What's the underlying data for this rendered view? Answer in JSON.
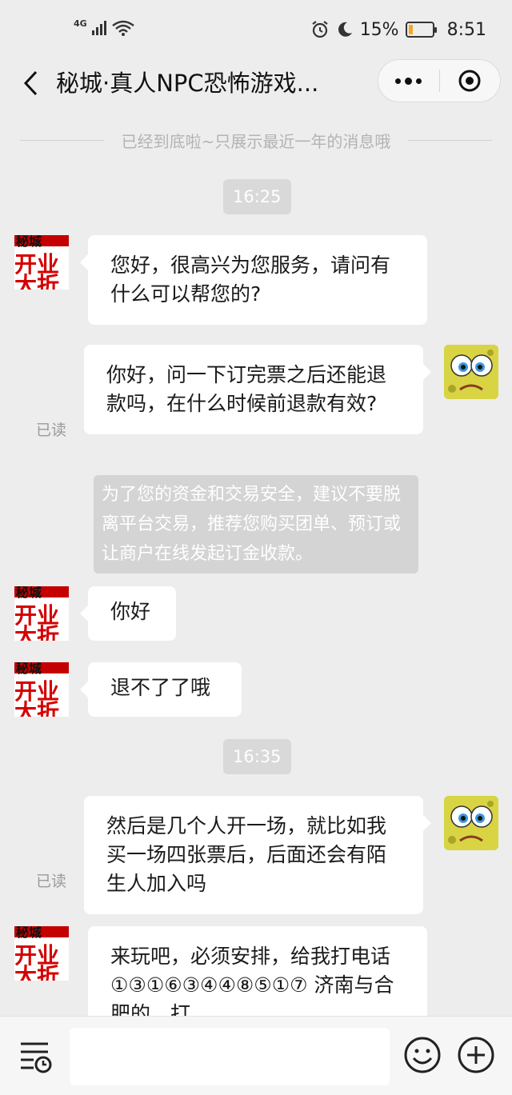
{
  "status_bar": {
    "network": "4G",
    "battery": "15%",
    "time": "8:51",
    "battery_level_percent": 15,
    "battery_color": "#f5a623"
  },
  "header": {
    "title": "秘城·真人NPC恐怖游戏..."
  },
  "chat": {
    "history_note": "已经到底啦~只展示最近一年的消息哦",
    "messages": [
      {
        "time": "16:25"
      },
      {
        "from": "shop",
        "text": "您好，很高兴为您服务，请问有什么可以帮您的?"
      },
      {
        "from": "me",
        "text": "你好，问一下订完票之后还能退款吗，在什么时候前退款有效?",
        "status": "已读"
      },
      {
        "system": "为了您的资金和交易安全，建议不要脱离平台交易，推荐您购买团单、预订或让商户在线发起订金收款。"
      },
      {
        "from": "shop",
        "text": "你好"
      },
      {
        "from": "shop",
        "text": "退不了了哦"
      },
      {
        "time": "16:35"
      },
      {
        "from": "me",
        "text": "然后是几个人开一场，就比如我买一场四张票后，后面还会有陌生人加入吗",
        "status": "已读"
      },
      {
        "from": "shop",
        "text": "来玩吧，必须安排，给我打电话①③①⑥③④④⑧⑤①⑦ 济南与合肥的，打"
      }
    ]
  },
  "shop_avatar": {
    "line1": "秘城",
    "line2": "开业",
    "line3": "大折"
  },
  "colors": {
    "background": "#ededed",
    "bubble": "#ffffff",
    "time_pill": "#d9d9d9",
    "system_note": "#d4d4d4"
  },
  "icons": [
    "back-arrow",
    "more-dots",
    "mini-program-target",
    "voice-list",
    "emoji",
    "plus"
  ]
}
